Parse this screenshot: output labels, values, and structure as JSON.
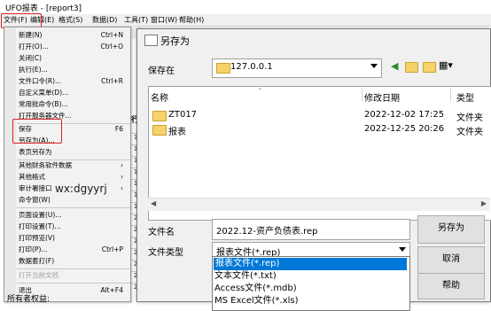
{
  "window": {
    "title": "UFO报表 - [report3]"
  },
  "menubar": {
    "items": [
      "文件(F)",
      "编辑(E)",
      "格式(S)",
      "数据(D)",
      "工具(T)",
      "窗口(W)",
      "帮助(H)"
    ]
  },
  "file_menu": {
    "items": [
      {
        "label": "新建(N)",
        "shortcut": "Ctrl+N"
      },
      {
        "label": "打开(O)...",
        "shortcut": "Ctrl+O"
      },
      {
        "label": "关闭(C)",
        "shortcut": ""
      },
      {
        "label": "执行(E)...",
        "shortcut": ""
      },
      {
        "label": "文件口令(R)...",
        "shortcut": "Ctrl+R"
      },
      {
        "label": "自定义菜单(D)...",
        "shortcut": ""
      },
      {
        "label": "常用批命令(B)...",
        "shortcut": ""
      },
      {
        "label": "打开服务器文件...",
        "shortcut": ""
      },
      {
        "label": "保存",
        "shortcut": "F6"
      },
      {
        "label": "另存为(A)...",
        "shortcut": ""
      },
      {
        "label": "表页另存为",
        "shortcut": ""
      },
      {
        "label": "其他财务软件数据",
        "shortcut": "›"
      },
      {
        "label": "其他格式",
        "shortcut": "›"
      },
      {
        "label": "审计署接口",
        "shortcut": "›"
      },
      {
        "label": "命令窗(W)",
        "shortcut": ""
      },
      {
        "label": "页面设置(U)...",
        "shortcut": ""
      },
      {
        "label": "打印设置(T)...",
        "shortcut": ""
      },
      {
        "label": "打印预览(V)",
        "shortcut": ""
      },
      {
        "label": "打印(P)...",
        "shortcut": "Ctrl+P"
      },
      {
        "label": "数据套打(F)",
        "shortcut": ""
      },
      {
        "label": "打开当前文档",
        "shortcut": ""
      },
      {
        "label": "退出",
        "shortcut": "Alt+F4"
      }
    ],
    "bottom_cut_text": "所有者权益:"
  },
  "sheet": {
    "row_numbers": [
      "1",
      "1",
      "1",
      "1",
      "1",
      "1",
      "1",
      "2",
      "2",
      "2",
      "2",
      "2",
      "2",
      "2"
    ],
    "col_cut": "行"
  },
  "watermark": "wx:dgyyrj",
  "dialog": {
    "title": "另存为",
    "save_in_label": "保存在",
    "save_in_value": "127.0.0.1",
    "columns": {
      "name": "名称",
      "date": "修改日期",
      "type": "类型"
    },
    "files": [
      {
        "name": "ZT017",
        "date": "2022-12-02 17:25",
        "type": "文件夹"
      },
      {
        "name": "报表",
        "date": "2022-12-25 20:26",
        "type": "文件夹"
      }
    ],
    "filename_label": "文件名",
    "filename_value": "2022.12-资产负债表.rep",
    "filetype_label": "文件类型",
    "filetype_value": "报表文件(*.rep)",
    "filetype_options": [
      "报表文件(*.rep)",
      "文本文件(*.txt)",
      "Access文件(*.mdb)",
      "MS Excel文件(*.xls)"
    ],
    "buttons": {
      "save": "另存为",
      "cancel": "取消",
      "help": "帮助"
    }
  }
}
